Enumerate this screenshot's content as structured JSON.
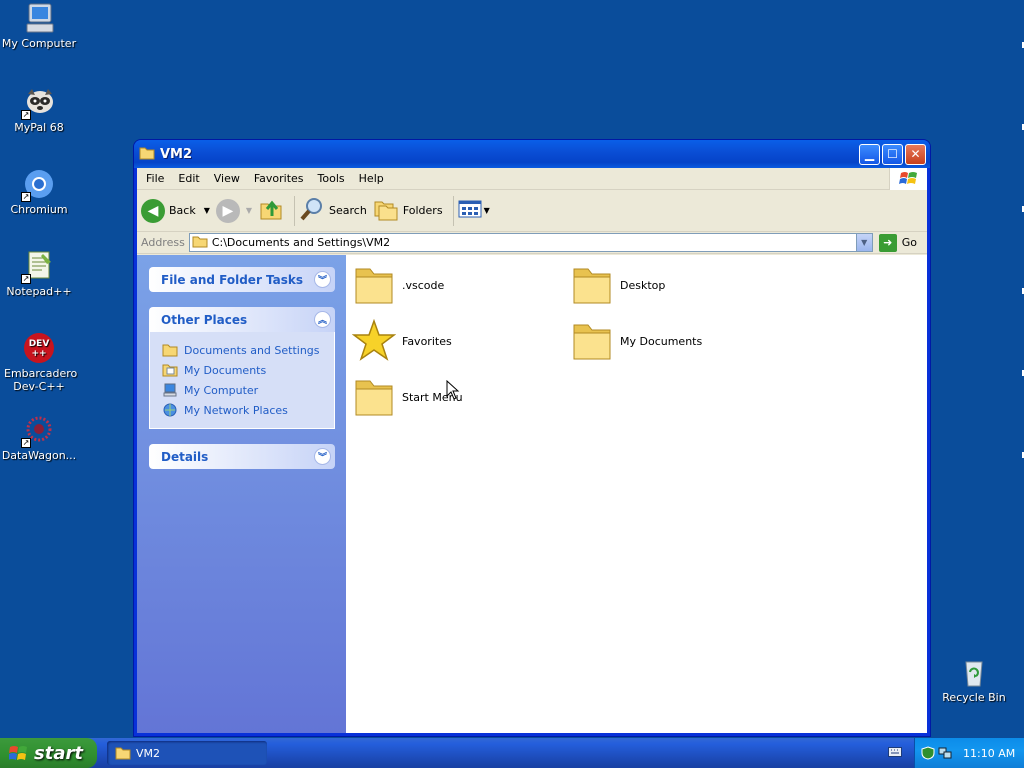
{
  "desktop": {
    "icons": [
      {
        "label": "My Computer"
      },
      {
        "label": "MyPal 68"
      },
      {
        "label": "Chromium"
      },
      {
        "label": "Notepad++"
      },
      {
        "label": "Embarcadero Dev-C++"
      },
      {
        "label": "DataWagon..."
      },
      {
        "label": "Recycle Bin"
      }
    ]
  },
  "window": {
    "title": "VM2",
    "menu": [
      "File",
      "Edit",
      "View",
      "Favorites",
      "Tools",
      "Help"
    ],
    "toolbar": {
      "back": "Back",
      "search": "Search",
      "folders": "Folders"
    },
    "address": {
      "label": "Address",
      "value": "C:\\Documents and Settings\\VM2",
      "go": "Go"
    },
    "taskpane": {
      "sections": [
        {
          "title": "File and Folder Tasks",
          "chevron": "down"
        },
        {
          "title": "Other Places",
          "chevron": "up",
          "links": [
            "Documents and Settings",
            "My Documents",
            "My Computer",
            "My Network Places"
          ]
        },
        {
          "title": "Details",
          "chevron": "down"
        }
      ]
    },
    "files": [
      {
        "name": ".vscode",
        "icon": "folder-icon"
      },
      {
        "name": "Desktop",
        "icon": "folder-icon"
      },
      {
        "name": "Favorites",
        "icon": "star-icon"
      },
      {
        "name": "My Documents",
        "icon": "folder-icon"
      },
      {
        "name": "Start Menu",
        "icon": "folder-icon"
      }
    ]
  },
  "taskbar": {
    "start": "start",
    "task": "VM2",
    "clock": "11:10 AM"
  },
  "colors": {
    "desktop": "#0a4d9b",
    "titlebar": "#0a4fd6",
    "taskpane_link": "#215dc6",
    "start": "#2f8f2f"
  }
}
